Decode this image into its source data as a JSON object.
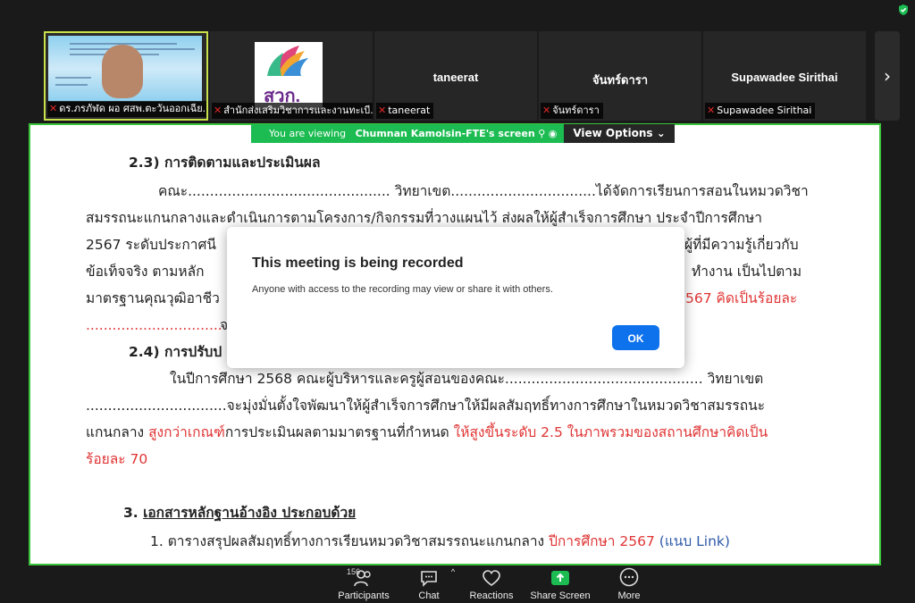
{
  "participants_strip": {
    "tiles": [
      {
        "name": "ดร.ภรภัฬด ผอ ศสพ.ตะวันออกเฉีย...",
        "muted": true
      },
      {
        "name": "สำนักส่งเสริมวิชาการและงานทะเบี...",
        "muted": true,
        "logo_text": "สวก."
      },
      {
        "name": "taneerat",
        "center_name": "taneerat",
        "muted": true
      },
      {
        "name": "จันทร์ดารา",
        "center_name": "จันทร์ดารา",
        "muted": true
      },
      {
        "name": "Supawadee Sirithai",
        "center_name": "Supawadee Sirithai",
        "muted": true
      }
    ],
    "next_icon": "chevron-right-icon"
  },
  "view_bar": {
    "prefix": "You are viewing",
    "presenter": "Chumnan Kamolsin-FTE's screen",
    "options_label": "View Options",
    "options_icon": "chevron-down-icon"
  },
  "document": {
    "h23": "2.3) การติดตามและประเมินผล",
    "p1_l1": "คณะ.............................................. วิทยาเขต.................................ได้จัดการเรียนการสอนในหมวดวิชา",
    "p1_l2": "สมรรถนะแกนกลางและดำเนินการตามโครงการ/กิจกรรมที่วางแผนไว้ ส่งผลให้ผู้สำเร็จการศึกษา ประจำปีการศึกษา",
    "p1_l3a": "2567 ระดับประกาศนี",
    "p1_l3b": "ผู้ที่มีความรู้เกี่ยวกับ",
    "p1_l4a": "ข้อเท็จจริง ตามหลัก",
    "p1_l4b": "ทำงาน เป็นไปตาม",
    "p1_l5a": "มาตรฐานคุณวุฒิอาชีว",
    "p1_l5b": "567 คิดเป็นร้อยละ",
    "p1_l6a": "...............................",
    "p1_l6b": "จ",
    "h24": "2.4) การปรับป",
    "p2_l1": "ในปีการศึกษา 2568 คณะผู้บริหารและครูผู้สอนของคณะ............................................. วิทยาเขต",
    "p2_l2": "................................จะมุ่งมั่นตั้งใจพัฒนาให้ผู้สำเร็จการศึกษาให้มีผลสัมฤทธิ์ทางการศึกษาในหมวดวิชาสมรรถนะ",
    "p2_l3a": "แกนกลาง ",
    "p2_l3b": "สูงกว่าเกณฑ์",
    "p2_l3c": "การประเมินผลตามมาตรฐานที่กำหนด ",
    "p2_l3d": "ให้สูงขึ้นระดับ 2.5 ในภาพรวมของสถานศึกษาคิดเป็น",
    "p2_l4": "ร้อยละ 70",
    "h3_num": "3. ",
    "h3_text": "เอกสารหลักฐานอ้างอิง  ประกอบด้วย",
    "item1a": "1. ตารางสรุปผลสัมฤทธิ์ทางการเรียนหมวดวิชาสมรรถนะแกนกลาง ",
    "item1b": "ปีการศึกษา 2567",
    "item1c": " (แนบ Link)"
  },
  "modal": {
    "title": "This meeting is being recorded",
    "body": "Anyone with access to the recording may view or share it with others.",
    "ok_label": "OK"
  },
  "toolbar": {
    "participants_label": "Participants",
    "participants_count": "156",
    "chat_label": "Chat",
    "reactions_label": "Reactions",
    "share_label": "Share Screen",
    "more_label": "More"
  },
  "colors": {
    "accent_green": "#1cbc52",
    "active_border": "#c8e04a",
    "ok_blue": "#0e72ed",
    "doc_red": "#e03434",
    "link_blue": "#2f5aa8"
  }
}
